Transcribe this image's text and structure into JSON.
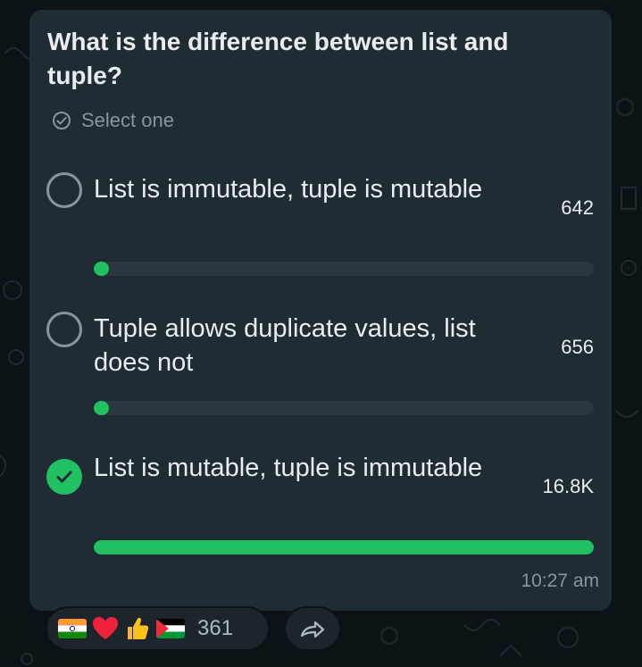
{
  "poll": {
    "question": "What is the difference between list and tuple?",
    "select_hint": "Select one",
    "options": [
      {
        "text": "List is immutable, tuple is mutable",
        "votes": "642",
        "fraction": 0.03,
        "selected": false
      },
      {
        "text": "Tuple allows duplicate values, list does not",
        "votes": "656",
        "fraction": 0.03,
        "selected": false
      },
      {
        "text": "List is mutable, tuple is immutable",
        "votes": "16.8K",
        "fraction": 1.0,
        "selected": true
      }
    ],
    "timestamp": "10:27 am"
  },
  "reactions": {
    "emojis": [
      "india-flag",
      "red-heart",
      "thumbs-up",
      "palestine-flag"
    ],
    "count": "361"
  },
  "colors": {
    "accent": "#21c063",
    "bubble": "#202c33",
    "background": "#0c1317",
    "text": "#e9edef",
    "muted": "#8696a0"
  }
}
